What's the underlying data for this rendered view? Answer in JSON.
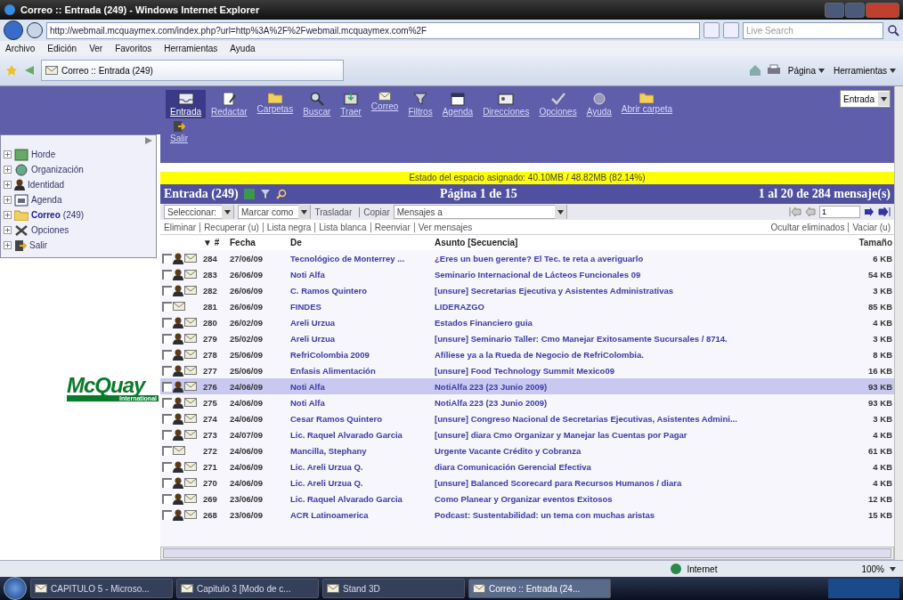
{
  "window": {
    "title": "Correo :: Entrada (249) - Windows Internet Explorer"
  },
  "address_bar": {
    "url": "http://webmail.mcquaymex.com/index.php?url=http%3A%2F%2Fwebmail.mcquaymex.com%2F",
    "search_placeholder": "Live Search"
  },
  "menu": [
    "Archivo",
    "Edición",
    "Ver",
    "Favoritos",
    "Herramientas",
    "Ayuda"
  ],
  "browser_tab": {
    "title": "Correo :: Entrada (249)"
  },
  "command_bar": [
    "Página",
    "Herramientas"
  ],
  "sidebar": {
    "items": [
      {
        "label": "Horde"
      },
      {
        "label": "Organización"
      },
      {
        "label": "Identidad"
      },
      {
        "label": "Agenda"
      },
      {
        "label": "Correo",
        "count": "(249)",
        "selected": true
      },
      {
        "label": "Opciones"
      },
      {
        "label": "Salir"
      }
    ],
    "logo": {
      "name": "McQuay",
      "subtitle": "International"
    }
  },
  "toolbar": {
    "items": [
      {
        "label": "Entrada",
        "selected": true
      },
      {
        "label": "Redactar",
        "selected": false
      },
      {
        "label": "Carpetas",
        "selected": false
      },
      {
        "label": "Buscar",
        "selected": false
      },
      {
        "label": "Traer",
        "selected": false
      },
      {
        "label": "Correo",
        "selected": false
      },
      {
        "label": "Filtros",
        "selected": false
      },
      {
        "label": "Agenda",
        "selected": false
      },
      {
        "label": "Direcciones",
        "selected": false
      },
      {
        "label": "Opciones",
        "selected": false
      },
      {
        "label": "Ayuda",
        "selected": false
      },
      {
        "label": "Abrir carpeta",
        "selected": false
      }
    ],
    "folder_select": "Entrada",
    "logout": "Salir"
  },
  "quota": "Estado del espacio asignado: 40.10MB / 48.82MB (82.14%)",
  "mailbox": {
    "title": "Entrada (249)",
    "page": "Página 1 de 15",
    "range": "1 al 20 de 284 mensaje(s)",
    "select_label": "Seleccionar:",
    "mark_label": "Marcar como",
    "move_links": [
      "Trasladar",
      "Copiar"
    ],
    "target": "Mensajes a",
    "page_input": "1",
    "actions": [
      "Eliminar",
      "Recuperar (u)",
      "Lista negra",
      "Lista blanca",
      "Reenviar",
      "Ver mensajes"
    ],
    "right_actions": [
      "Ocultar eliminados",
      "Vaciar (u)"
    ]
  },
  "table": {
    "columns": [
      "▼ #",
      "Fecha",
      "De",
      "Asunto [Secuencia]",
      "Tamaño"
    ],
    "rows": [
      {
        "num": "284",
        "date": "27/06/09",
        "from": "Tecnológico de Monterrey ...",
        "subject": "¿Eres un buen gerente? El Tec. te reta a averiguarlo",
        "size": "6 KB",
        "contact": true,
        "selected": false
      },
      {
        "num": "283",
        "date": "26/06/09",
        "from": "Noti Alfa",
        "subject": "Seminario Internacional de Lácteos Funcionales 09",
        "size": "54 KB",
        "contact": true,
        "selected": false
      },
      {
        "num": "282",
        "date": "26/06/09",
        "from": "C. Ramos Quintero",
        "subject": "[unsure] Secretarias Ejecutiva y Asistentes Administrativas",
        "size": "3 KB",
        "contact": true,
        "selected": false
      },
      {
        "num": "281",
        "date": "26/06/09",
        "from": "FINDES",
        "subject": "LIDERAZGO",
        "size": "85 KB",
        "contact": false,
        "selected": false
      },
      {
        "num": "280",
        "date": "26/02/09",
        "from": "Areli Urzua",
        "subject": "Estados Financiero guia",
        "size": "4 KB",
        "contact": true,
        "selected": false
      },
      {
        "num": "279",
        "date": "25/02/09",
        "from": "Areli Urzua",
        "subject": "[unsure] Seminario Taller: Cmo Manejar Exitosamente Sucursales / 8714.",
        "size": "3 KB",
        "contact": true,
        "selected": false
      },
      {
        "num": "278",
        "date": "25/06/09",
        "from": "RefriColombia 2009",
        "subject": "Afíliese ya a la Rueda de Negocio de RefriColombia.",
        "size": "8 KB",
        "contact": true,
        "selected": false
      },
      {
        "num": "277",
        "date": "25/06/09",
        "from": "Enfasis Alimentación",
        "subject": "[unsure] Food Technology Summit Mexico09",
        "size": "16 KB",
        "contact": true,
        "selected": false
      },
      {
        "num": "276",
        "date": "24/06/09",
        "from": "Noti Alfa",
        "subject": "NotiAlfa 223 (23 Junio 2009)",
        "size": "93 KB",
        "contact": true,
        "selected": true
      },
      {
        "num": "275",
        "date": "24/06/09",
        "from": "Noti Alfa",
        "subject": "NotiAlfa 223 (23 Junio 2009)",
        "size": "93 KB",
        "contact": true,
        "selected": false
      },
      {
        "num": "274",
        "date": "24/06/09",
        "from": "Cesar Ramos Quintero",
        "subject": "[unsure] Congreso Nacional de Secretarias Ejecutivas, Asistentes Admini...",
        "size": "3 KB",
        "contact": true,
        "selected": false
      },
      {
        "num": "273",
        "date": "24/07/09",
        "from": "Lic. Raquel Alvarado Garcia",
        "subject": "[unsure] diara Cmo Organizar y Manejar las Cuentas por Pagar",
        "size": "4 KB",
        "contact": true,
        "selected": false
      },
      {
        "num": "272",
        "date": "24/06/09",
        "from": "Mancilla, Stephany",
        "subject": "Urgente Vacante Crédito y Cobranza",
        "size": "61 KB",
        "contact": false,
        "selected": false
      },
      {
        "num": "271",
        "date": "24/06/09",
        "from": "Lic. Areli Urzua Q.",
        "subject": "diara Comunicación Gerencial Efectiva",
        "size": "4 KB",
        "contact": true,
        "selected": false
      },
      {
        "num": "270",
        "date": "24/06/09",
        "from": "Lic. Areli Urzua Q.",
        "subject": "[unsure] Balanced Scorecard para Recursos Humanos / diara",
        "size": "4 KB",
        "contact": true,
        "selected": false
      },
      {
        "num": "269",
        "date": "23/06/09",
        "from": "Lic. Raquel Alvarado Garcia",
        "subject": "Como Planear y Organizar eventos Exitosos",
        "size": "12 KB",
        "contact": true,
        "selected": false
      },
      {
        "num": "268",
        "date": "23/06/09",
        "from": "ACR Latinoamerica",
        "subject": "Podcast: Sustentabilidad: un tema con muchas aristas",
        "size": "15 KB",
        "contact": true,
        "selected": false
      }
    ]
  },
  "status_bar": {
    "zone": "Internet",
    "zoom": "100%"
  },
  "taskbar": {
    "items": [
      {
        "label": "CAPITULO 5 - Microso...",
        "selected": false
      },
      {
        "label": "Capitulo 3 [Modo de c...",
        "selected": false
      },
      {
        "label": "Stand 3D",
        "selected": false
      },
      {
        "label": "Correo :: Entrada (24...",
        "selected": true
      }
    ]
  }
}
